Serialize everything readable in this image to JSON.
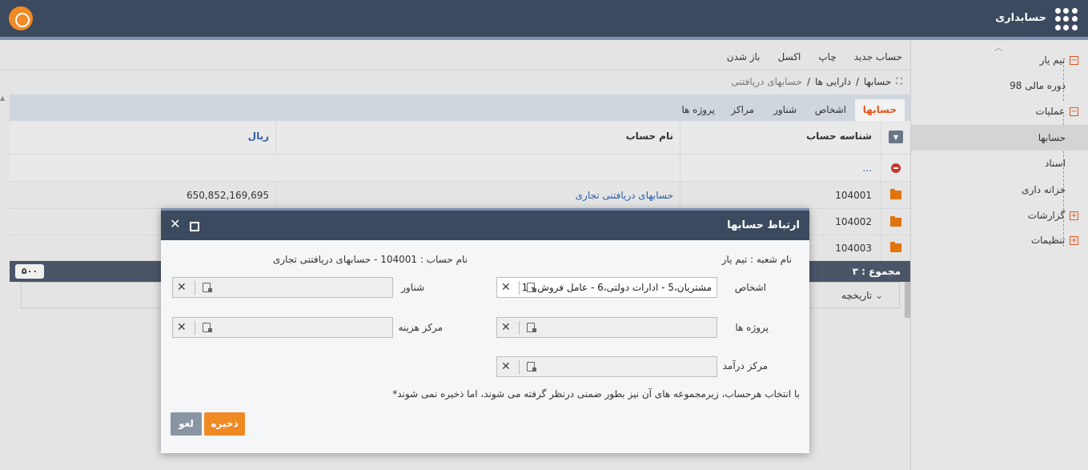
{
  "app": {
    "title": "حسابداری"
  },
  "sidebar": {
    "items": [
      {
        "label": "تیم یار",
        "expander": "−"
      },
      {
        "label": "دوره مالی 98"
      },
      {
        "label": "عملیات",
        "expander": "−"
      },
      {
        "label": "حسابها"
      },
      {
        "label": "اسناد"
      },
      {
        "label": "خزانه داری"
      },
      {
        "label": "گزارشات",
        "expander": "+"
      },
      {
        "label": "تنظیمات",
        "expander": "+"
      }
    ]
  },
  "toolbar": {
    "new_account": "حساب جدید",
    "print": "چاپ",
    "excel": "اکسل",
    "open": "باز شدن"
  },
  "breadcrumb": {
    "items": [
      "حسابها",
      "دارایی ها",
      "حسابهای دریافتنی"
    ],
    "separator": "/"
  },
  "tabs": [
    "حسابها",
    "اشخاص",
    "شناور",
    "مراکز",
    "پروژه ها"
  ],
  "table": {
    "headers": {
      "code": "شناسه حساب",
      "name": "نام حساب",
      "currency": "ریال"
    },
    "back_row": {
      "code": "..."
    },
    "rows": [
      {
        "code": "104001",
        "name": "حسابهای دریافتنی تجاری",
        "amount": "650,852,169,695"
      },
      {
        "code": "104002",
        "name": "",
        "amount": ""
      },
      {
        "code": "104003",
        "name": "",
        "amount": ""
      }
    ]
  },
  "footer": {
    "total_label": "مجموع : ۳",
    "page_size": "۵۰۰",
    "history_label": "تاریخچه"
  },
  "modal": {
    "title": "ارتباط حسابها",
    "branch": "نام شعبه : تیم یار",
    "account": "نام حساب : 104001 - حسابهای دریافتنی تجاری",
    "fields": {
      "persons": {
        "label": "اشخاص",
        "value": "1 - مشتریان،5 - ادارات دولتی،6 - عامل فروش"
      },
      "float": {
        "label": "شناور",
        "value": ""
      },
      "projects": {
        "label": "پروژه ها",
        "value": ""
      },
      "cost_center": {
        "label": "مرکز هزینه",
        "value": ""
      },
      "income_center": {
        "label": "مرکز درآمد",
        "value": ""
      }
    },
    "note": "*با انتخاب هرحساب، زیرمجموعه های آن نیز بطور ضمنی درنظر گرفته می شوند، اما ذخیره نمی شوند",
    "save_label": "ذخیره",
    "cancel_label": "لغو"
  },
  "colors": {
    "header_bg": "#3b4a5e",
    "accent": "#f08a24",
    "link": "#2a5ea8",
    "folder": "#e0740e"
  }
}
